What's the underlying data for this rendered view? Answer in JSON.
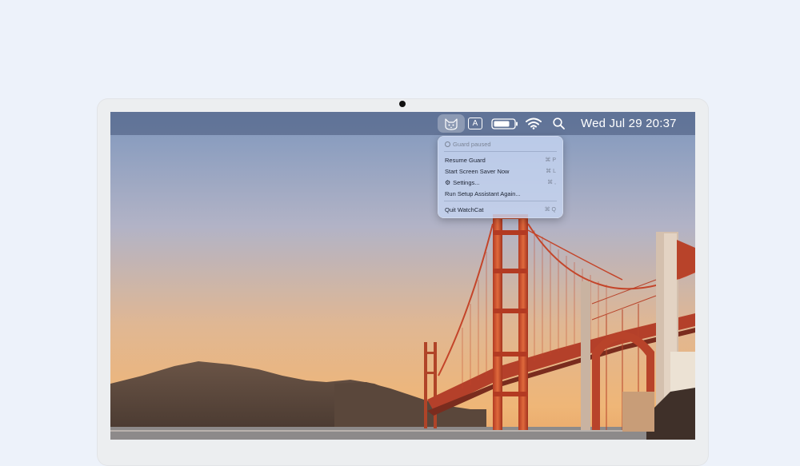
{
  "menubar": {
    "app_icon": "cat-icon",
    "input_source_label": "A",
    "battery_icon": "battery-icon",
    "wifi_icon": "wifi-icon",
    "search_icon": "search-icon",
    "clock": "Wed Jul 29 20:37"
  },
  "menu": {
    "status_label": "Guard paused",
    "items": [
      {
        "label": "Resume Guard",
        "shortcut": "⌘ P"
      },
      {
        "label": "Start Screen Saver Now",
        "shortcut": "⌘ L"
      },
      {
        "label": "Settings...",
        "shortcut": "⌘ ,",
        "icon": "gear-icon"
      },
      {
        "label": "Run Setup Assistant Again..."
      },
      {
        "label": "Quit WatchCat",
        "shortcut": "⌘ Q"
      }
    ]
  },
  "colors": {
    "page_background": "#edf2fa",
    "menu_background": "#c6d4f0",
    "bridge_red": "#c4452a"
  }
}
